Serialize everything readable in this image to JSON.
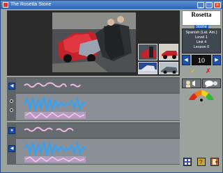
{
  "window": {
    "title": "The Rosetta Stone",
    "minimize": "_",
    "maximize": "□",
    "close": "×"
  },
  "logo": {
    "line1": "Rosetta",
    "line2": "Stone"
  },
  "info": {
    "language": "Spanish (Lat. Am.)",
    "level": "Level 1",
    "unit": "Unit 4",
    "lesson": "Lesson 0"
  },
  "nav": {
    "counter": "10",
    "prev_glyph": "◀",
    "next_glyph": "▶"
  },
  "marks": {
    "check": "✓",
    "x": "✗"
  },
  "audio": {
    "play_glyph": "◀",
    "record_glyph": "●"
  },
  "colors": {
    "waveform_blue": "#3aa0f0",
    "pitch_pink": "#e9b7e6",
    "window_bg": "#9ca39e"
  }
}
